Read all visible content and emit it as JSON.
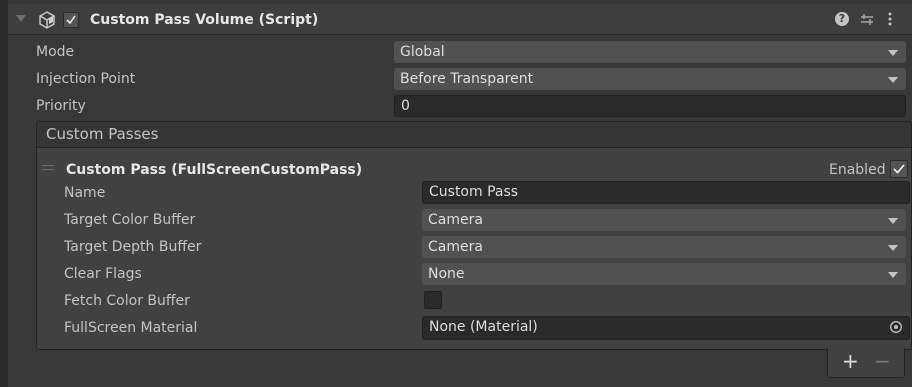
{
  "colors": {
    "panel": "#383838",
    "header": "#3e3e3e",
    "field": "#515151",
    "text_field": "#2a2a2a",
    "text": "#c4c4c4"
  },
  "header": {
    "title": "Custom Pass Volume (Script)",
    "enabled": true,
    "icons": [
      "foldout-arrow-icon",
      "custom-pass-volume-icon",
      "help-icon",
      "presets-icon",
      "kebab-menu-icon"
    ]
  },
  "volume": {
    "mode": {
      "label": "Mode",
      "value": "Global"
    },
    "injection_point": {
      "label": "Injection Point",
      "value": "Before Transparent"
    },
    "priority": {
      "label": "Priority",
      "value": "0"
    }
  },
  "custom_passes": {
    "title": "Custom Passes",
    "pass": {
      "title": "Custom Pass (FullScreenCustomPass)",
      "enabled_label": "Enabled",
      "enabled": true,
      "name": {
        "label": "Name",
        "value": "Custom Pass"
      },
      "target_color_buffer": {
        "label": "Target Color Buffer",
        "value": "Camera"
      },
      "target_depth_buffer": {
        "label": "Target Depth Buffer",
        "value": "Camera"
      },
      "clear_flags": {
        "label": "Clear Flags",
        "value": "None"
      },
      "fetch_color_buffer": {
        "label": "Fetch Color Buffer",
        "checked": false
      },
      "fullscreen_material": {
        "label": "FullScreen Material",
        "value": "None (Material)"
      }
    },
    "add_label": "+",
    "remove_label": "−"
  }
}
